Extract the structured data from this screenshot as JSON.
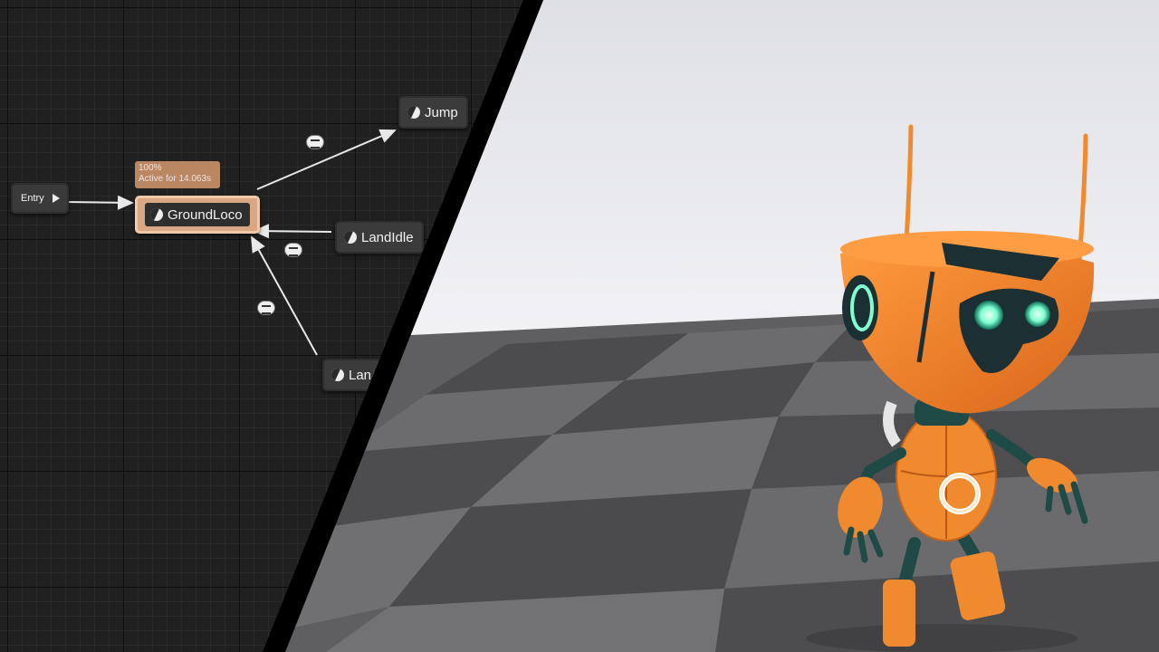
{
  "state_machine": {
    "entry_label": "Entry",
    "states": {
      "ground_loco": "GroundLoco",
      "jump": "Jump",
      "land_idle": "LandIdle",
      "land": "Lan"
    },
    "active_state_info": {
      "weight": "100%",
      "active_time": "Active for 14.063s"
    }
  },
  "viewport": {
    "character": "orange robot",
    "colors": {
      "sky": "#e9eaee",
      "floor_light": "#6a6a6c",
      "floor_dark": "#4e4e50",
      "robot_orange": "#f08a2e",
      "robot_teal": "#1f4a45",
      "eye_glow": "#7fffd0"
    }
  }
}
